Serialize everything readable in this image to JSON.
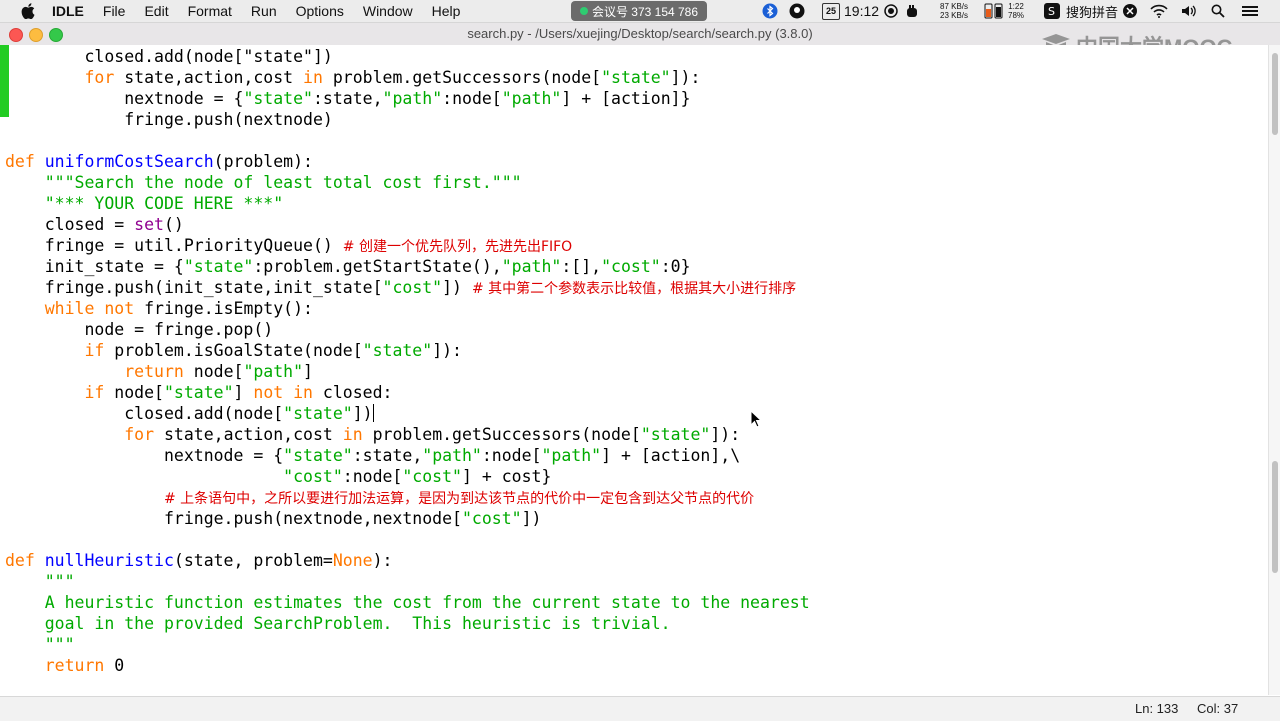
{
  "menubar": {
    "app_name": "IDLE",
    "menus": [
      "File",
      "Edit",
      "Format",
      "Run",
      "Options",
      "Window",
      "Help"
    ],
    "meeting": "会议号 373 154 786",
    "clock": "19:12",
    "date_badge": "25",
    "net_up": "87 KB/s",
    "net_down": "23 KB/s",
    "battery_time": "1:22",
    "battery_pct": "78%",
    "ime": "搜狗拼音"
  },
  "window": {
    "title": "search.py - /Users/xuejing/Desktop/search/search.py (3.8.0)",
    "watermark": "中国大学MOOC"
  },
  "code": {
    "l1": "closed.add(node[\"state\"])",
    "l2_a": "for",
    "l2_b": " state,action,cost ",
    "l2_c": "in",
    "l2_d": " problem.getSuccessors(node[",
    "l2_e": "\"state\"",
    "l2_f": "]):",
    "l3_a": "nextnode = {",
    "l3_b": "\"state\"",
    "l3_c": ":state,",
    "l3_d": "\"path\"",
    "l3_e": ":node[",
    "l3_f": "\"path\"",
    "l3_g": "] + [action]}",
    "l4": "fringe.push(nextnode)",
    "l5_a": "def",
    "l5_b": "uniformCostSearch",
    "l5_c": "(problem):",
    "l6": "\"\"\"Search the node of least total cost first.\"\"\"",
    "l7": "\"*** YOUR CODE HERE ***\"",
    "l8_a": "closed = ",
    "l8_b": "set",
    "l8_c": "()",
    "l9_a": "fringe = util.PriorityQueue() ",
    "l9_b": "# 创建一个优先队列，先进先出FIFO",
    "l10_a": "init_state = {",
    "l10_b": "\"state\"",
    "l10_c": ":problem.getStartState(),",
    "l10_d": "\"path\"",
    "l10_e": ":[],",
    "l10_f": "\"cost\"",
    "l10_g": ":0}",
    "l11_a": "fringe.push(init_state,init_state[",
    "l11_b": "\"cost\"",
    "l11_c": "]) ",
    "l11_d": "# 其中第二个参数表示比较值，根据其大小进行排序",
    "l12_a": "while",
    "l12_b": " ",
    "l12_c": "not",
    "l12_d": " fringe.isEmpty():",
    "l13": "node = fringe.pop()",
    "l14_a": "if",
    "l14_b": " problem.isGoalState(node[",
    "l14_c": "\"state\"",
    "l14_d": "]):",
    "l15_a": "return",
    "l15_b": " node[",
    "l15_c": "\"path\"",
    "l15_d": "]",
    "l16_a": "if",
    "l16_b": " node[",
    "l16_c": "\"state\"",
    "l16_d": "] ",
    "l16_e": "not in",
    "l16_f": " closed:",
    "l17_a": "closed.add(node[",
    "l17_b": "\"state\"",
    "l17_c": "])",
    "l18_a": "for",
    "l18_b": " state,action,cost ",
    "l18_c": "in",
    "l18_d": " problem.getSuccessors(node[",
    "l18_e": "\"state\"",
    "l18_f": "]):",
    "l19_a": "nextnode = {",
    "l19_b": "\"state\"",
    "l19_c": ":state,",
    "l19_d": "\"path\"",
    "l19_e": ":node[",
    "l19_f": "\"path\"",
    "l19_g": "] + [action],\\",
    "l20_a": "\"cost\"",
    "l20_b": ":node[",
    "l20_c": "\"cost\"",
    "l20_d": "] + cost}",
    "l21": "# 上条语句中，之所以要进行加法运算，是因为到达该节点的代价中一定包含到达父节点的代价",
    "l22_a": "fringe.push(nextnode,nextnode[",
    "l22_b": "\"cost\"",
    "l22_c": "])",
    "l23_a": "def",
    "l23_b": "nullHeuristic",
    "l23_c": "(state, problem=",
    "l23_d": "None",
    "l23_e": "):",
    "l24": "\"\"\"",
    "l25": "A heuristic function estimates the cost from the current state to the nearest",
    "l26": "goal in the provided SearchProblem.  This heuristic is trivial.",
    "l27": "\"\"\"",
    "l28_a": "return",
    "l28_b": " 0"
  },
  "status": {
    "line": "Ln: 133",
    "col": "Col: 37"
  }
}
